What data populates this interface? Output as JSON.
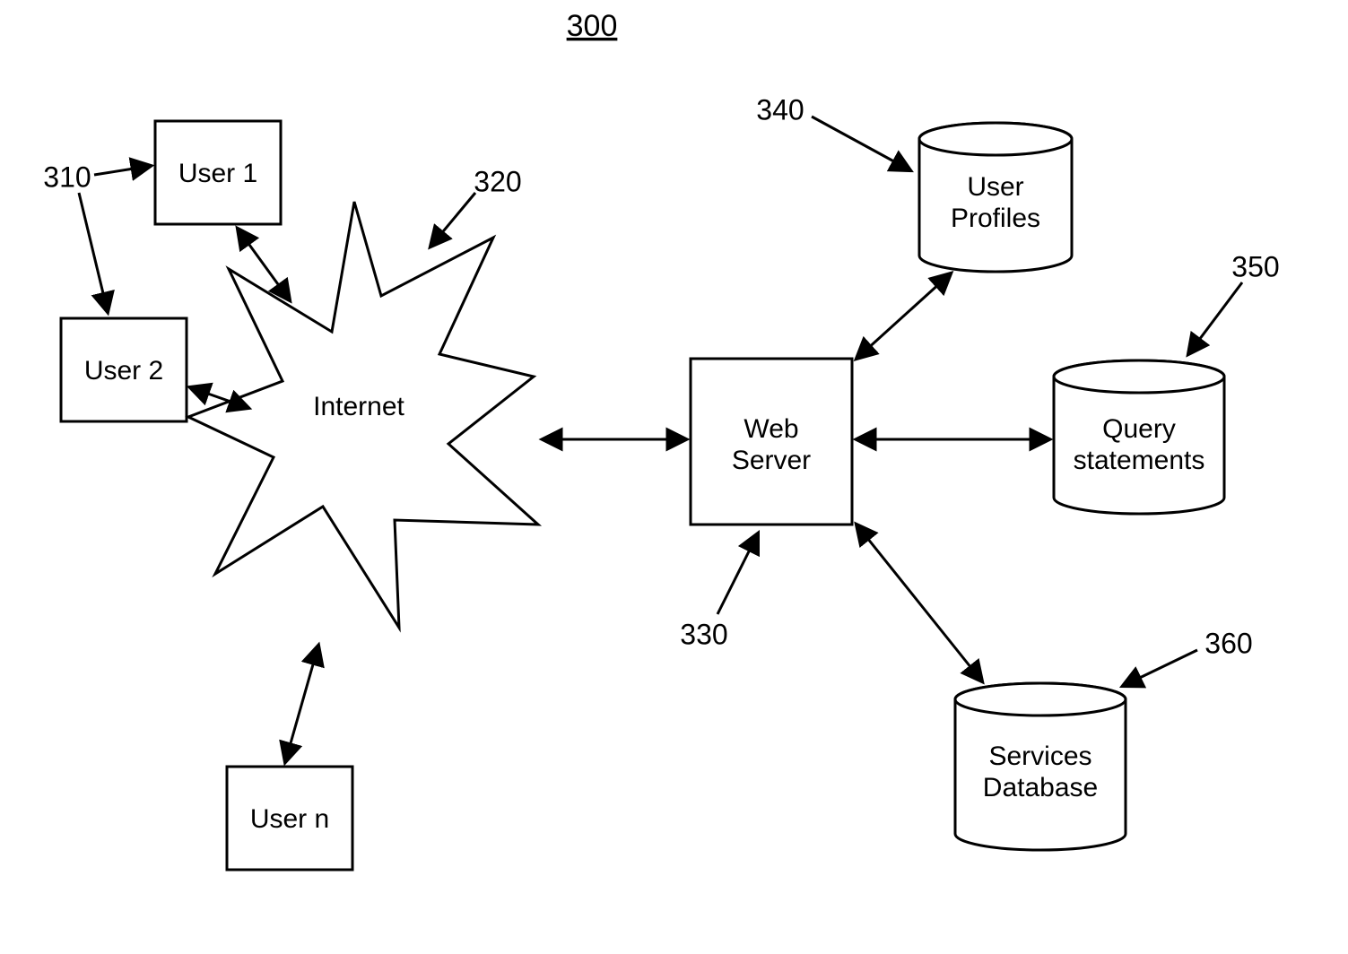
{
  "title": "300",
  "nodes": {
    "user1": {
      "label": "User 1",
      "ref": "310"
    },
    "user2": {
      "label": "User 2",
      "ref": "310"
    },
    "usern": {
      "label": "User n"
    },
    "internet": {
      "label": "Internet",
      "ref": "320"
    },
    "web": {
      "label_line1": "Web",
      "label_line2": "Server",
      "ref": "330"
    },
    "profiles": {
      "label_line1": "User",
      "label_line2": "Profiles",
      "ref": "340"
    },
    "query": {
      "label_line1": "Query",
      "label_line2": "statements",
      "ref": "350"
    },
    "services": {
      "label_line1": "Services",
      "label_line2": "Database",
      "ref": "360"
    }
  }
}
